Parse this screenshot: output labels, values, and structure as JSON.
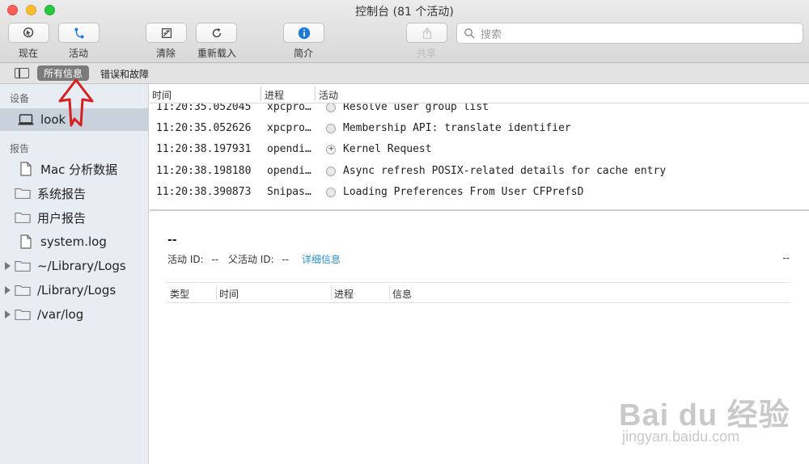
{
  "window": {
    "title": "控制台 (81 个活动)"
  },
  "toolbar": {
    "now_label": "现在",
    "activities_label": "活动",
    "clear_label": "清除",
    "reload_label": "重新载入",
    "info_label": "简介",
    "share_label": "共享",
    "search_placeholder": "搜索",
    "accent_color": "#1f7ad9"
  },
  "filterbar": {
    "all_messages": "所有信息",
    "errors_faults": "错误和故障"
  },
  "sidebar": {
    "devices_header": "设备",
    "device": "look",
    "reports_header": "报告",
    "items": [
      {
        "label": "Mac 分析数据",
        "icon": "document-icon"
      },
      {
        "label": "系统报告",
        "icon": "folder-icon"
      },
      {
        "label": "用户报告",
        "icon": "folder-icon"
      },
      {
        "label": "system.log",
        "icon": "document-icon"
      },
      {
        "label": "~/Library/Logs",
        "icon": "folder-icon"
      },
      {
        "label": "/Library/Logs",
        "icon": "folder-icon"
      },
      {
        "label": "/var/log",
        "icon": "folder-icon"
      }
    ]
  },
  "log": {
    "columns": [
      "时间",
      "进程",
      "活动"
    ],
    "rows": [
      {
        "time": "11:20:35.052045",
        "process": "xpcpro…",
        "activity": "Resolve user group list"
      },
      {
        "time": "11:20:35.052626",
        "process": "xpcpro…",
        "activity": "Membership API: translate identifier"
      },
      {
        "time": "11:20:38.197931",
        "process": "opendi…",
        "activity": "Kernel Request"
      },
      {
        "time": "11:20:38.198180",
        "process": "opendi…",
        "activity": "Async refresh POSIX-related details for cache entry"
      },
      {
        "time": "11:20:38.390873",
        "process": "Snipas…",
        "activity": "Loading Preferences From User CFPrefsD"
      }
    ]
  },
  "detail": {
    "title": "--",
    "activity_id_label": "活动 ID:",
    "activity_id_value": "--",
    "parent_id_label": "父活动 ID:",
    "parent_id_value": "--",
    "details_link": "详细信息",
    "right_value": "--",
    "columns": [
      "类型",
      "时间",
      "进程",
      "信息"
    ]
  },
  "watermark": {
    "brand": "Bai du 经验",
    "url": "jingyan.baidu.com"
  }
}
